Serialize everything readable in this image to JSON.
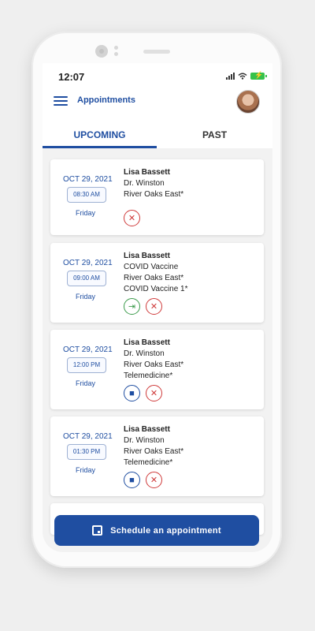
{
  "status": {
    "time": "12:07"
  },
  "header": {
    "title": "Appointments"
  },
  "tabs": [
    {
      "label": "UPCOMING",
      "active": true
    },
    {
      "label": "PAST",
      "active": false
    }
  ],
  "appointments": [
    {
      "date": "OCT 29, 2021",
      "time": "08:30 AM",
      "day": "Friday",
      "lines": [
        "Lisa Bassett",
        "Dr. Winston",
        "River Oaks East*"
      ],
      "actions": [
        "cancel"
      ]
    },
    {
      "date": "OCT 29, 2021",
      "time": "09:00 AM",
      "day": "Friday",
      "lines": [
        "Lisa Bassett",
        "COVID Vaccine",
        "River Oaks East*",
        "COVID Vaccine 1*"
      ],
      "actions": [
        "check-in",
        "cancel"
      ]
    },
    {
      "date": "OCT 29, 2021",
      "time": "12:00 PM",
      "day": "Friday",
      "lines": [
        "Lisa Bassett",
        "Dr. Winston",
        "River Oaks East*",
        "Telemedicine*"
      ],
      "actions": [
        "video",
        "cancel"
      ]
    },
    {
      "date": "OCT 29, 2021",
      "time": "01:30 PM",
      "day": "Friday",
      "lines": [
        "Lisa Bassett",
        "Dr. Winston",
        "River Oaks East*",
        "Telemedicine*"
      ],
      "actions": [
        "video",
        "cancel"
      ]
    }
  ],
  "footer": {
    "schedule_label": "Schedule an appointment"
  },
  "colors": {
    "primary": "#1f4ea1",
    "cancel": "#cf3a3a",
    "checkin": "#3a9a4a"
  }
}
